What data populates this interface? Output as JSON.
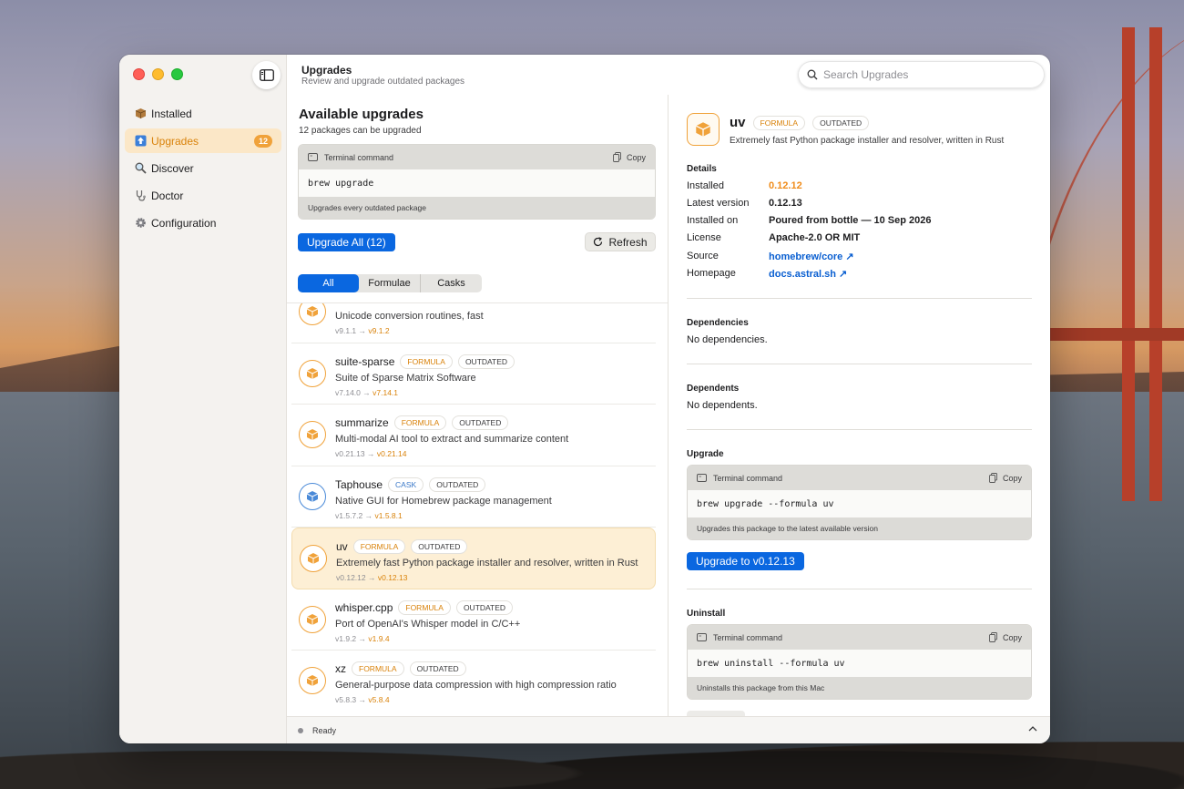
{
  "sidebar": {
    "items": [
      {
        "label": "Installed",
        "icon": "box-icon",
        "active": false
      },
      {
        "label": "Upgrades",
        "icon": "arrow-up-icon",
        "active": true,
        "badge": "12"
      },
      {
        "label": "Discover",
        "icon": "magnifier-icon",
        "active": false
      },
      {
        "label": "Doctor",
        "icon": "stethoscope-icon",
        "active": false
      },
      {
        "label": "Configuration",
        "icon": "gear-icon",
        "active": false
      }
    ]
  },
  "header": {
    "title": "Upgrades",
    "subtitle": "Review and upgrade outdated packages",
    "search_placeholder": "Search Upgrades"
  },
  "main": {
    "title": "Available upgrades",
    "subtitle": "12 packages can be upgraded",
    "terminal": {
      "label": "Terminal command",
      "copy": "Copy",
      "command": "brew upgrade",
      "footer": "Upgrades every outdated package"
    },
    "upgrade_all": "Upgrade All (12)",
    "refresh": "Refresh",
    "filters": [
      "All",
      "Formulae",
      "Casks"
    ],
    "packages": [
      {
        "name": "",
        "kind": "",
        "status": "",
        "desc": "Unicode conversion routines, fast",
        "from": "v9.1.1",
        "to": "v9.1.2",
        "selected": false
      },
      {
        "name": "suite-sparse",
        "kind": "FORMULA",
        "status": "OUTDATED",
        "desc": "Suite of Sparse Matrix Software",
        "from": "v7.14.0",
        "to": "v7.14.1",
        "selected": false
      },
      {
        "name": "summarize",
        "kind": "FORMULA",
        "status": "OUTDATED",
        "desc": "Multi-modal AI tool to extract and summarize content",
        "from": "v0.21.13",
        "to": "v0.21.14",
        "selected": false
      },
      {
        "name": "Taphouse",
        "kind": "CASK",
        "status": "OUTDATED",
        "desc": "Native GUI for Homebrew package management",
        "from": "v1.5.7.2",
        "to": "v1.5.8.1",
        "selected": false
      },
      {
        "name": "uv",
        "kind": "FORMULA",
        "status": "OUTDATED",
        "desc": "Extremely fast Python package installer and resolver, written in Rust",
        "from": "v0.12.12",
        "to": "v0.12.13",
        "selected": true
      },
      {
        "name": "whisper.cpp",
        "kind": "FORMULA",
        "status": "OUTDATED",
        "desc": "Port of OpenAI's Whisper model in C/C++",
        "from": "v1.9.2",
        "to": "v1.9.4",
        "selected": false
      },
      {
        "name": "xz",
        "kind": "FORMULA",
        "status": "OUTDATED",
        "desc": "General-purpose data compression with high compression ratio",
        "from": "v5.8.3",
        "to": "v5.8.4",
        "selected": false
      }
    ]
  },
  "detail": {
    "name": "uv",
    "kind": "FORMULA",
    "status": "OUTDATED",
    "desc": "Extremely fast Python package installer and resolver, written in Rust",
    "details_title": "Details",
    "details": [
      {
        "key": "Installed",
        "value": "0.12.12",
        "style": "orange"
      },
      {
        "key": "Latest version",
        "value": "0.12.13",
        "style": "plain"
      },
      {
        "key": "Installed on",
        "value": "Poured from bottle — 10 Sep 2026",
        "style": "plain"
      },
      {
        "key": "License",
        "value": "Apache-2.0 OR MIT",
        "style": "plain"
      },
      {
        "key": "Source",
        "value": "homebrew/core ↗",
        "style": "link"
      },
      {
        "key": "Homepage",
        "value": "docs.astral.sh ↗",
        "style": "link"
      }
    ],
    "dependencies_title": "Dependencies",
    "dependencies_text": "No dependencies.",
    "dependents_title": "Dependents",
    "dependents_text": "No dependents.",
    "upgrade_title": "Upgrade",
    "upgrade_terminal": {
      "label": "Terminal command",
      "copy": "Copy",
      "command": "brew upgrade --formula uv",
      "footer": "Upgrades this package to the latest available version"
    },
    "upgrade_button": "Upgrade to v0.12.13",
    "uninstall_title": "Uninstall",
    "uninstall_terminal": {
      "label": "Terminal command",
      "copy": "Copy",
      "command": "brew uninstall --formula uv",
      "footer": "Uninstalls this package from this Mac"
    }
  },
  "status": {
    "text": "Ready"
  },
  "colors": {
    "accent_orange": "#f0a23a",
    "primary_blue": "#0a67e0",
    "link_blue": "#0a5fd1"
  }
}
